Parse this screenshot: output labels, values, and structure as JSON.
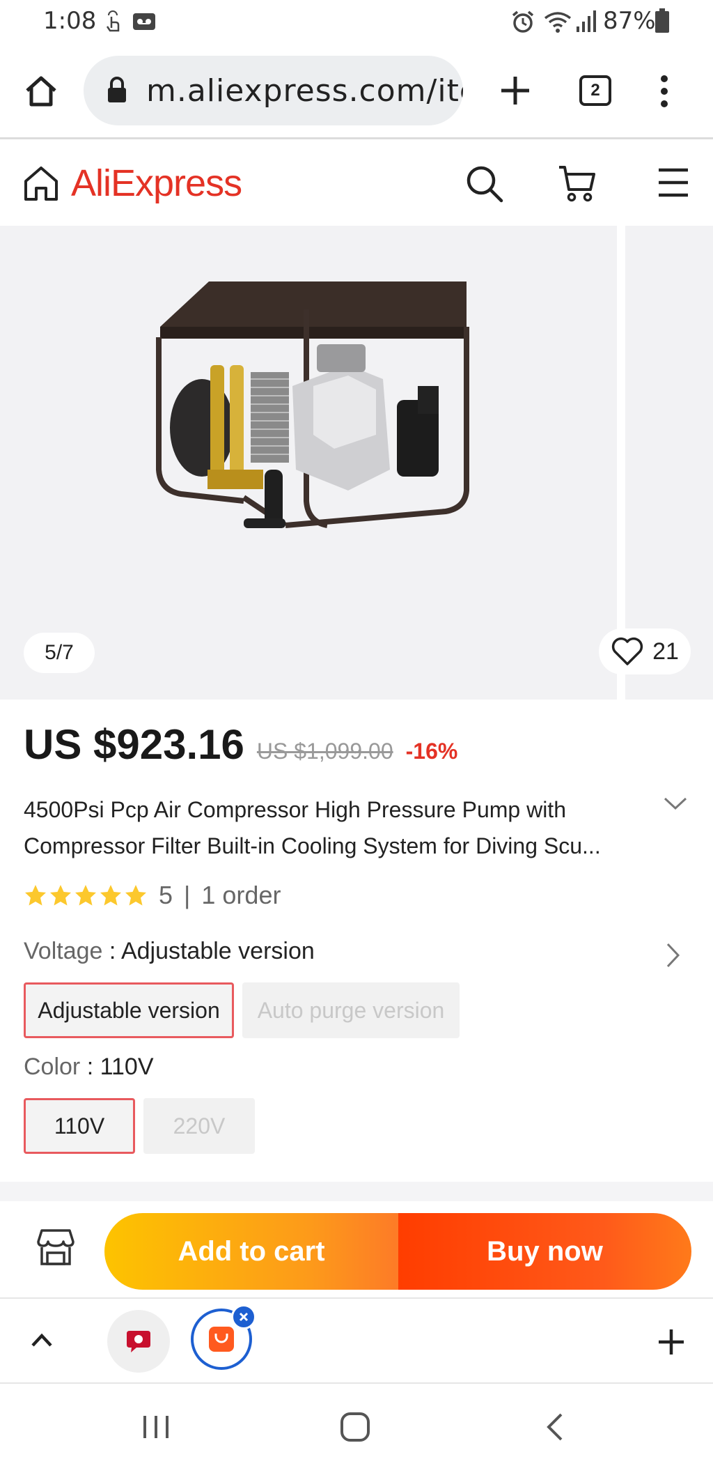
{
  "status_bar": {
    "time": "1:08",
    "battery": "87%"
  },
  "browser": {
    "url": "m.aliexpress.com/item/",
    "tab_count": "2"
  },
  "site": {
    "brand": "AliExpress"
  },
  "gallery": {
    "counter": "5/7",
    "wishlist_count": "21"
  },
  "product": {
    "price": "US $923.16",
    "original_price": "US $1,099.00",
    "discount": "-16%",
    "title": "4500Psi Pcp Air Compressor High Pressure Pump with Compressor Filter Built-in Cooling System for Diving Scu...",
    "rating": "5",
    "rating_separator": "|",
    "orders": "1 order",
    "star_count": 5
  },
  "variants": {
    "voltage": {
      "key": "Voltage",
      "selected": "Adjustable version",
      "options": [
        "Adjustable version",
        "Auto purge version"
      ]
    },
    "color": {
      "key": "Color",
      "selected": "110V",
      "options": [
        "110V",
        "220V"
      ]
    }
  },
  "actions": {
    "add_to_cart": "Add to cart",
    "buy_now": "Buy now"
  },
  "colors": {
    "brand_red": "#e43225",
    "selected_border": "#e85a5e",
    "add_cart_start": "#fdc300",
    "buy_now": "#ff3d00",
    "star": "#fcc82d"
  },
  "icons": {
    "status": [
      "touch-icon",
      "voicemail-icon",
      "alarm-icon",
      "wifi-icon",
      "signal-icon",
      "battery-icon"
    ],
    "browser": [
      "home-icon",
      "lock-icon",
      "plus-icon",
      "tabs-icon",
      "more-icon"
    ],
    "header": [
      "home-outline-icon",
      "search-icon",
      "cart-icon",
      "menu-icon"
    ],
    "bubbles": [
      "chevron-up-icon",
      "chat-bubble-icon",
      "aliexpress-app-bubble-icon",
      "close-icon",
      "plus-icon"
    ],
    "nav": [
      "recents-icon",
      "home-nav-icon",
      "back-icon"
    ]
  }
}
